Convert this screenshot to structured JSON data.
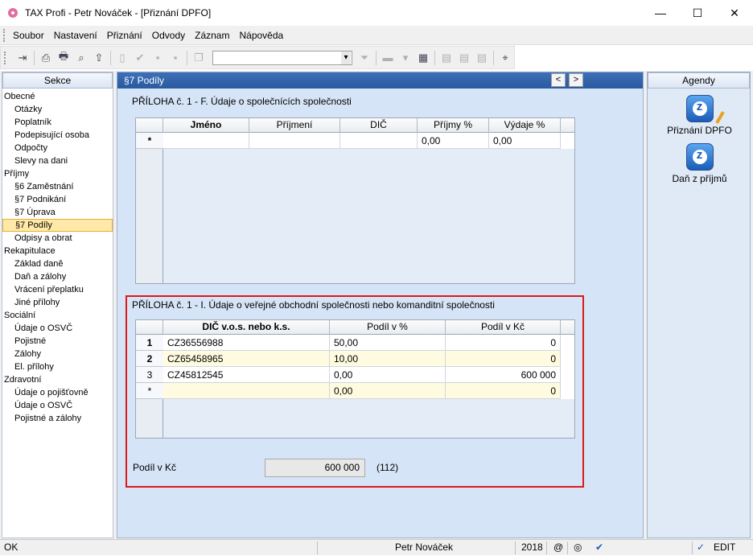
{
  "window": {
    "title": "TAX Profi - Petr Nováček - [Přiznání DPFO]",
    "min": "—",
    "max": "☐",
    "close": "✕"
  },
  "menu": [
    {
      "label": "Soubor"
    },
    {
      "label": "Nastavení"
    },
    {
      "label": "Přiznání"
    },
    {
      "label": "Odvody"
    },
    {
      "label": "Záznam"
    },
    {
      "label": "Nápověda"
    }
  ],
  "sekce": {
    "header": "Sekce",
    "items": [
      {
        "label": "Obecné",
        "level": 0
      },
      {
        "label": "Otázky",
        "level": 1
      },
      {
        "label": "Poplatník",
        "level": 1
      },
      {
        "label": "Podepisující osoba",
        "level": 1
      },
      {
        "label": "Odpočty",
        "level": 1
      },
      {
        "label": "Slevy na dani",
        "level": 1
      },
      {
        "label": "Příjmy",
        "level": 0
      },
      {
        "label": "§6 Zaměstnání",
        "level": 1
      },
      {
        "label": "§7 Podnikání",
        "level": 1
      },
      {
        "label": "§7 Úprava",
        "level": 1
      },
      {
        "label": "§7 Podíly",
        "level": 1,
        "selected": true
      },
      {
        "label": "Odpisy a obrat",
        "level": 1
      },
      {
        "label": "Rekapitulace",
        "level": 0
      },
      {
        "label": "Základ daně",
        "level": 1
      },
      {
        "label": "Daň a zálohy",
        "level": 1
      },
      {
        "label": "Vrácení přeplatku",
        "level": 1
      },
      {
        "label": "Jiné přílohy",
        "level": 1
      },
      {
        "label": "Sociální",
        "level": 0
      },
      {
        "label": "Údaje o OSVČ",
        "level": 1
      },
      {
        "label": "Pojistné",
        "level": 1
      },
      {
        "label": "Zálohy",
        "level": 1
      },
      {
        "label": "El. přílohy",
        "level": 1
      },
      {
        "label": "Zdravotní",
        "level": 0
      },
      {
        "label": "Údaje o pojišťovně",
        "level": 1
      },
      {
        "label": "Údaje o OSVČ",
        "level": 1
      },
      {
        "label": "Pojistné a zálohy",
        "level": 1
      }
    ]
  },
  "content": {
    "header": "§7 Podíly",
    "prev": "<",
    "next": ">",
    "section1": {
      "title": "PŘÍLOHA č. 1 - F. Údaje o společnících společnosti",
      "columns": [
        "Jméno",
        "Příjmení",
        "DIČ",
        "Příjmy %",
        "Výdaje %"
      ],
      "new_row": {
        "marker": "*",
        "prijmy": "0,00",
        "vydaje": "0,00"
      }
    },
    "section2": {
      "title": "PŘÍLOHA č. 1 - I. Údaje o veřejné obchodní společnosti nebo komanditní společnosti",
      "columns": [
        "DIČ v.o.s. nebo k.s.",
        "Podíl v %",
        "Podíl v Kč"
      ],
      "rows": [
        {
          "num": "1",
          "dic": "CZ36556988",
          "pct": "50,00",
          "kc": "0"
        },
        {
          "num": "2",
          "dic": "CZ65458965",
          "pct": "10,00",
          "kc": "0"
        },
        {
          "num": "3",
          "dic": "CZ45812545",
          "pct": "0,00",
          "kc": "600 000"
        },
        {
          "num": "*",
          "dic": "",
          "pct": "0,00",
          "kc": "0"
        }
      ],
      "total_label": "Podíl v Kč",
      "total_value": "600 000",
      "total_code": "(112)"
    }
  },
  "agendy": {
    "header": "Agendy",
    "items": [
      {
        "label": "Přiznání DPFO"
      },
      {
        "label": "Daň z příjmů"
      }
    ]
  },
  "status": {
    "left": "OK",
    "user": "Petr Nováček",
    "year": "2018",
    "at": "@",
    "mode": "EDIT"
  }
}
